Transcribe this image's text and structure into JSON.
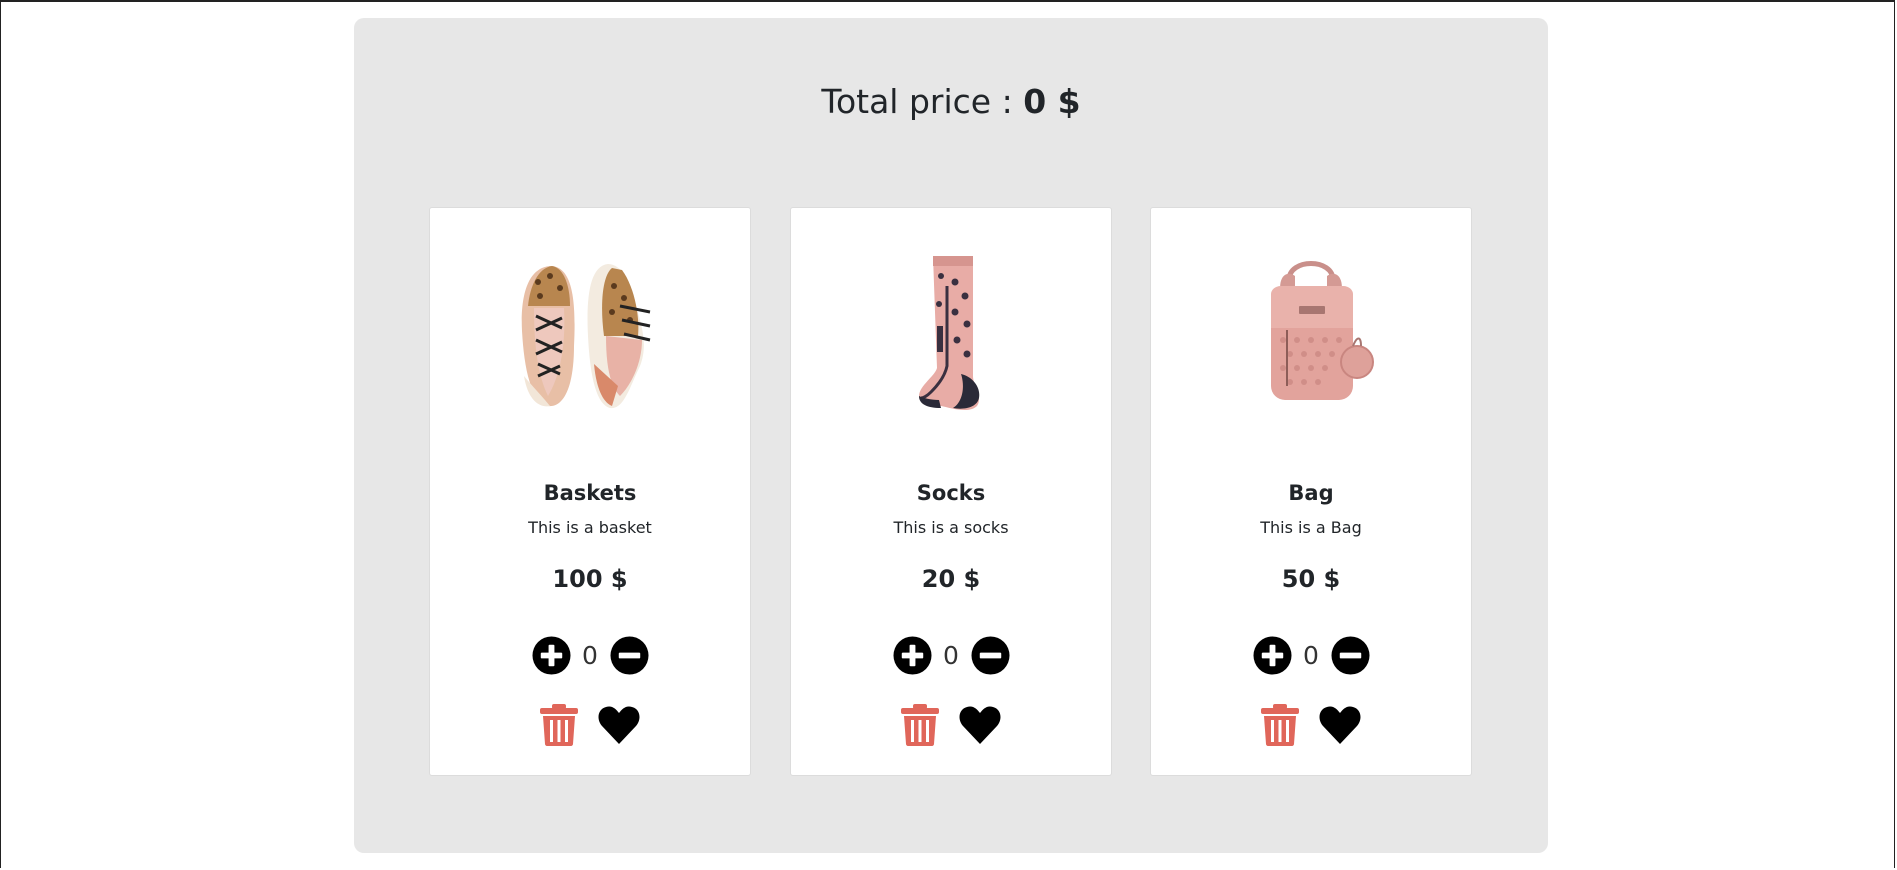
{
  "cart": {
    "total_label": "Total price :",
    "total_value": "0 $"
  },
  "products": [
    {
      "name": "Baskets",
      "description": "This is a basket",
      "price": "100 $",
      "quantity": "0",
      "image": "sneakers-image"
    },
    {
      "name": "Socks",
      "description": "This is a socks",
      "price": "20 $",
      "quantity": "0",
      "image": "sock-image"
    },
    {
      "name": "Bag",
      "description": "This is a Bag",
      "price": "50 $",
      "quantity": "0",
      "image": "backpack-image"
    }
  ],
  "colors": {
    "panel_background": "#e7e7e7",
    "card_background": "#ffffff",
    "trash_icon": "#e0665a",
    "heart_icon": "#000000",
    "quantity_buttons": "#000000",
    "product_pink": "#e8aca6"
  },
  "icons": {
    "increase": "plus-circle-icon",
    "decrease": "minus-circle-icon",
    "delete": "trash-icon",
    "favorite": "heart-icon"
  }
}
